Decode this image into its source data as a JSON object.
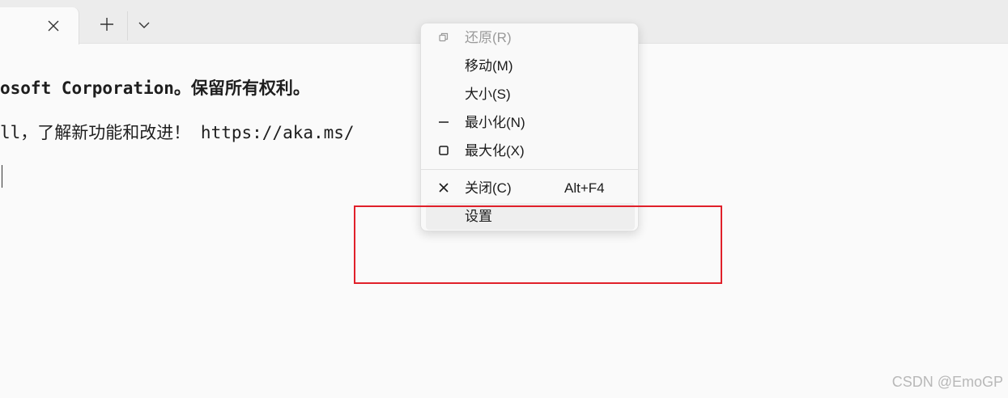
{
  "tab_bar": {
    "close_icon": "close-icon",
    "new_tab_icon": "plus-icon",
    "dropdown_icon": "chevron-down-icon"
  },
  "terminal": {
    "lines": [
      "osoft Corporation。保留所有权利。",
      "ll，了解新功能和改进！ https://aka.ms/"
    ]
  },
  "context_menu": {
    "items": [
      {
        "label": "还原(R)",
        "icon": "restore-icon",
        "enabled": false
      },
      {
        "label": "移动(M)",
        "icon": "",
        "enabled": true
      },
      {
        "label": "大小(S)",
        "icon": "",
        "enabled": true
      },
      {
        "label": "最小化(N)",
        "icon": "minimize-icon",
        "enabled": true
      },
      {
        "label": "最大化(X)",
        "icon": "maximize-icon",
        "enabled": true
      },
      {
        "label": "关闭(C)",
        "shortcut": "Alt+F4",
        "icon": "close-icon",
        "enabled": true
      },
      {
        "label": "设置",
        "icon": "",
        "enabled": true,
        "hovered": true
      }
    ]
  },
  "annotation": {
    "color": "#e0202a"
  },
  "watermark": "CSDN @EmoGP"
}
